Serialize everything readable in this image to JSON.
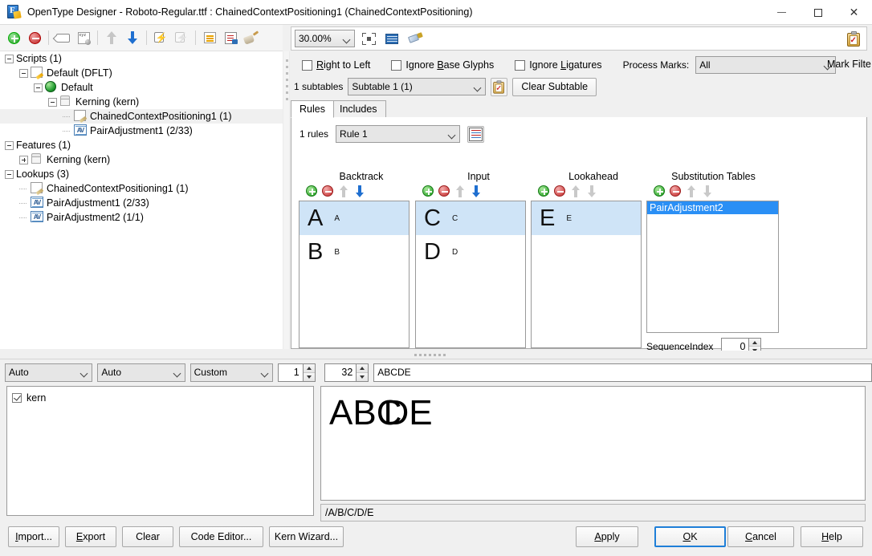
{
  "window": {
    "title": "OpenType Designer - Roboto-Regular.ttf : ChainedContextPositioning1 (ChainedContextPositioning)",
    "app_icon": "font-editor-icon",
    "minimize": "minimize-icon",
    "maximize": "maximize-icon",
    "close": "close-icon"
  },
  "left_toolbar": {
    "buttons": [
      {
        "name": "add-icon",
        "glyph": "plus-circle-green"
      },
      {
        "name": "remove-icon",
        "glyph": "minus-circle-red"
      },
      {
        "name": "rename-tag-icon",
        "glyph": "tag"
      },
      {
        "name": "glyph-properties-icon",
        "glyph": "xyz-sphere"
      },
      {
        "name": "move-up-icon",
        "glyph": "arrow-up"
      },
      {
        "name": "move-down-icon",
        "glyph": "arrow-down"
      },
      {
        "name": "compile-icon",
        "glyph": "page-bolt"
      },
      {
        "name": "compile-all-icon",
        "glyph": "pages-bolt"
      },
      {
        "name": "organize-icon",
        "glyph": "tree-list"
      },
      {
        "name": "report-icon",
        "glyph": "document-red"
      },
      {
        "name": "clean-icon",
        "glyph": "broom"
      }
    ]
  },
  "tree": {
    "nodes": [
      {
        "label": "Scripts (1)",
        "indent": 0,
        "expander": "minus",
        "icon": null,
        "selected": false
      },
      {
        "label": "Default (DFLT)",
        "indent": 1,
        "expander": "minus",
        "icon": "script-pencil-icon",
        "selected": false
      },
      {
        "label": "Default",
        "indent": 2,
        "expander": "minus",
        "icon": "language-globe-icon",
        "selected": false
      },
      {
        "label": "Kerning (kern)",
        "indent": 3,
        "expander": "minus",
        "icon": "feature-box-icon",
        "selected": false
      },
      {
        "label": "ChainedContextPositioning1 (1)",
        "indent": 4,
        "expander": "leaf",
        "icon": "lookup-pencil-icon",
        "selected": true
      },
      {
        "label": "PairAdjustment1 (2/33)",
        "indent": 4,
        "expander": "leaf",
        "icon": "lookup-av-icon",
        "selected": false
      },
      {
        "label": "Features (1)",
        "indent": 0,
        "expander": "minus",
        "icon": null,
        "selected": false
      },
      {
        "label": "Kerning (kern)",
        "indent": 1,
        "expander": "plus",
        "icon": "feature-box-icon",
        "selected": false
      },
      {
        "label": "Lookups (3)",
        "indent": 0,
        "expander": "minus",
        "icon": null,
        "selected": false
      },
      {
        "label": "ChainedContextPositioning1 (1)",
        "indent": 1,
        "expander": "leaf",
        "icon": "lookup-pencil-icon",
        "selected": false
      },
      {
        "label": "PairAdjustment1 (2/33)",
        "indent": 1,
        "expander": "leaf",
        "icon": "lookup-av-icon",
        "selected": false
      },
      {
        "label": "PairAdjustment2 (1/1)",
        "indent": 1,
        "expander": "leaf",
        "icon": "lookup-av-icon",
        "selected": false
      }
    ]
  },
  "zoombar": {
    "zoom_value": "30.00%",
    "fit_icon": "fit-to-window-icon",
    "grid_icon": "grid-view-icon",
    "pen_icon": "edit-pen-icon",
    "clipboard_icon": "clipboard-check-icon"
  },
  "options": {
    "right_to_left": {
      "label": "Right to Left",
      "mnemonic": "R",
      "checked": false
    },
    "ignore_base_glyphs": {
      "label": "Ignore Base Glyphs",
      "mnemonic": "B",
      "checked": false
    },
    "ignore_ligatures": {
      "label": "Ignore Ligatures",
      "mnemonic": "L",
      "checked": false
    },
    "process_marks_label": "Process Marks:",
    "process_marks_value": "All",
    "mark_filter_label": "Mark Filte"
  },
  "subtable": {
    "count_label": "1 subtables",
    "selected": "Subtable 1 (1)",
    "clipboard_icon": "clipboard-check-icon",
    "clear_button": "Clear Subtable"
  },
  "tabs": [
    {
      "label": "Rules",
      "active": true
    },
    {
      "label": "Includes",
      "active": false
    }
  ],
  "rules": {
    "count_label": "1 rules",
    "selected_rule": "Rule 1",
    "rules_icon": "rules-list-icon",
    "columns": [
      {
        "title": "Backtrack",
        "name": "backtrack",
        "ops": [
          {
            "name": "add-backtrack-icon",
            "kind": "plus",
            "enabled": true
          },
          {
            "name": "remove-backtrack-icon",
            "kind": "minus",
            "enabled": true
          },
          {
            "name": "move-up-backtrack-icon",
            "kind": "up",
            "enabled": false
          },
          {
            "name": "move-down-backtrack-icon",
            "kind": "down",
            "enabled": true
          }
        ],
        "items": [
          {
            "glyph": "A",
            "label": "A",
            "selected": true
          },
          {
            "glyph": "B",
            "label": "B",
            "selected": false
          }
        ]
      },
      {
        "title": "Input",
        "name": "input",
        "ops": [
          {
            "name": "add-input-icon",
            "kind": "plus",
            "enabled": true
          },
          {
            "name": "remove-input-icon",
            "kind": "minus",
            "enabled": true
          },
          {
            "name": "move-up-input-icon",
            "kind": "up",
            "enabled": false
          },
          {
            "name": "move-down-input-icon",
            "kind": "down",
            "enabled": true
          }
        ],
        "items": [
          {
            "glyph": "C",
            "label": "C",
            "selected": true
          },
          {
            "glyph": "D",
            "label": "D",
            "selected": false
          }
        ]
      },
      {
        "title": "Lookahead",
        "name": "lookahead",
        "ops": [
          {
            "name": "add-lookahead-icon",
            "kind": "plus",
            "enabled": true
          },
          {
            "name": "remove-lookahead-icon",
            "kind": "minus",
            "enabled": true
          },
          {
            "name": "move-up-lookahead-icon",
            "kind": "up",
            "enabled": false
          },
          {
            "name": "move-down-lookahead-icon",
            "kind": "down",
            "enabled": false
          }
        ],
        "items": [
          {
            "glyph": "E",
            "label": "E",
            "selected": true
          }
        ]
      }
    ],
    "substitution_tables": {
      "title": "Substitution Tables",
      "ops": [
        {
          "name": "add-substitution-icon",
          "kind": "plus",
          "enabled": true
        },
        {
          "name": "remove-substitution-icon",
          "kind": "minus",
          "enabled": true
        },
        {
          "name": "move-up-substitution-icon",
          "kind": "up",
          "enabled": false
        },
        {
          "name": "move-down-substitution-icon",
          "kind": "down",
          "enabled": false
        }
      ],
      "items": [
        {
          "label": "PairAdjustment2",
          "selected": true
        }
      ],
      "sequence_index_label": "SequenceIndex",
      "sequence_index_value": "0"
    }
  },
  "bottom_controls": {
    "shaper_engine": "Auto",
    "direction": "Auto",
    "feature_set": "Custom",
    "line_count": "1",
    "font_size": "32",
    "sample_text": "ABCDE"
  },
  "feature_list": [
    {
      "label": "kern",
      "checked": true
    }
  ],
  "preview": {
    "render_text_part1": "AB",
    "render_text_part2": "C",
    "render_text_part3": "D",
    "render_text_part4": "E",
    "status_text": "/A/B/C/D/E"
  },
  "buttons": {
    "import": {
      "label": "Import...",
      "mnemonic": "I"
    },
    "export": {
      "label": "Export",
      "mnemonic": "E"
    },
    "clear": {
      "label": "Clear",
      "mnemonic": ""
    },
    "code_editor": {
      "label": "Code Editor...",
      "mnemonic": ""
    },
    "kern_wizard": {
      "label": "Kern Wizard...",
      "mnemonic": ""
    },
    "apply": {
      "label": "Apply",
      "mnemonic": "A"
    },
    "ok": {
      "label": "OK",
      "mnemonic": "O"
    },
    "cancel": {
      "label": "Cancel",
      "mnemonic": "C"
    },
    "help": {
      "label": "Help",
      "mnemonic": "H"
    }
  },
  "colors": {
    "selection_blue": "#2a8ff5",
    "list_highlight": "#cfe4f7",
    "tree_selection": "#f0f0f0",
    "default_button_border": "#1f7fd8",
    "window_bg": "#f0f0f0"
  }
}
